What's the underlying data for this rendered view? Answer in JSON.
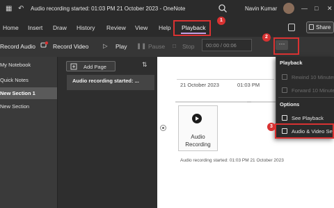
{
  "titlebar": {
    "title": "Audio recording started: 01:03 PM 21 October 2023  -  OneNote",
    "user_name": "Navin Kumar",
    "window_controls": [
      "minimize-icon",
      "maximize-icon",
      "close-icon"
    ]
  },
  "ribbon": {
    "tabs": [
      "Home",
      "Insert",
      "Draw",
      "History",
      "Review",
      "View",
      "Help",
      "Playback"
    ],
    "active_tab": "Playback",
    "share_label": "Share"
  },
  "toolbar": {
    "record_audio": "Record Audio",
    "record_video": "Record Video",
    "play": "Play",
    "pause": "Pause",
    "stop": "Stop",
    "time": "00:00 / 00:06",
    "more": "···"
  },
  "sidebar": {
    "items": [
      {
        "label": "My Notebook"
      },
      {
        "label": "Quick Notes"
      },
      {
        "label": "New Section 1",
        "selected": true
      },
      {
        "label": "New Section"
      }
    ]
  },
  "pagelist": {
    "add_page": "Add Page",
    "items": [
      "Audio recording started: ..."
    ]
  },
  "page": {
    "date": "21 October 2023",
    "time": "01:03 PM",
    "audio_label": "Audio Recording",
    "caption": "Audio recording started: 01:03 PM 21 October 2023"
  },
  "dropdown": {
    "section_playback": "Playback",
    "rewind": "Rewind 10 Minutes",
    "forward": "Forward 10 Minutes",
    "section_options": "Options",
    "see_playback": "See Playback",
    "audio_video_settings": "Audio & Video Settings"
  },
  "annotations": {
    "badges": [
      "1",
      "2",
      "3"
    ],
    "color": "#d93232"
  },
  "colors": {
    "accent": "#c7a0e6",
    "chrome": "#2b2b2b",
    "canvas": "#ffffff"
  }
}
